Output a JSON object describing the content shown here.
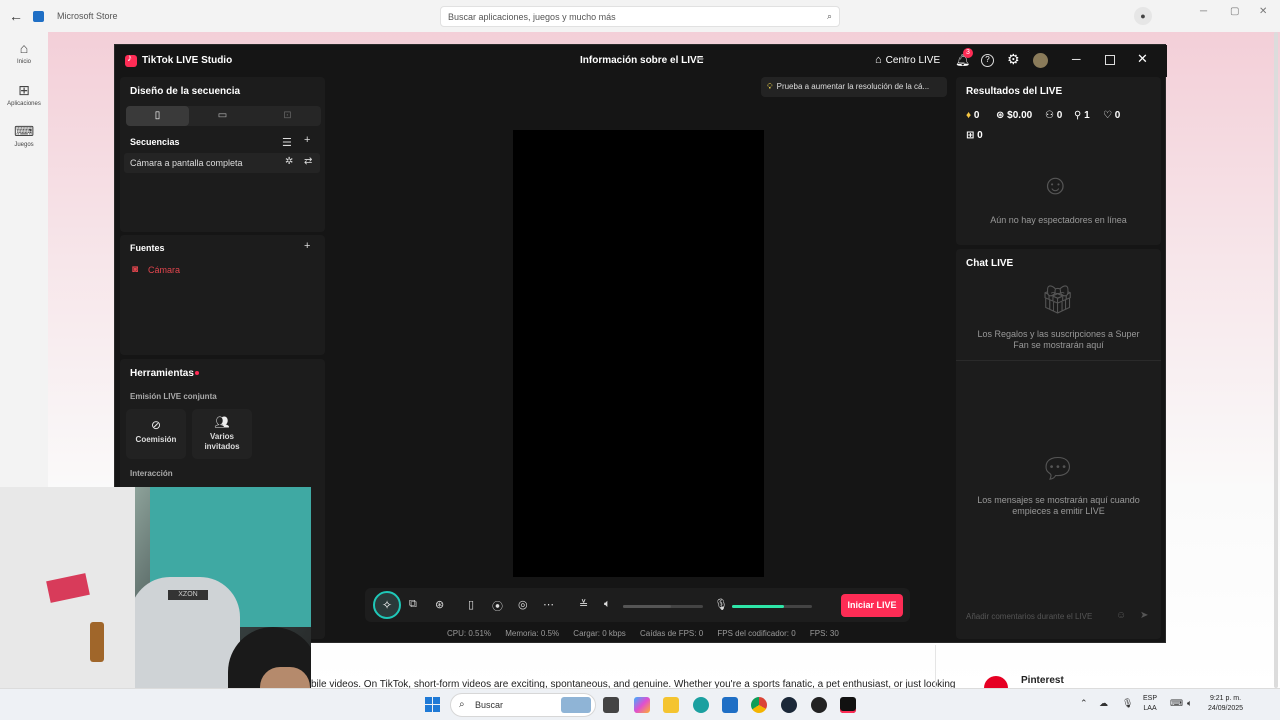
{
  "store": {
    "title": "Microsoft Store",
    "search_placeholder": "Buscar aplicaciones, juegos y mucho más",
    "nav": [
      {
        "label": "Inicio",
        "icon": "home-icon"
      },
      {
        "label": "Aplicaciones",
        "icon": "apps-icon"
      },
      {
        "label": "Juegos",
        "icon": "gamepad-icon"
      }
    ],
    "bottom_text": "bile videos. On TikTok, short-form videos are exciting, spontaneous, and genuine. Whether you're a sports fanatic, a pet enthusiast, or just looking",
    "pinterest_label": "Pinterest"
  },
  "tiktok": {
    "app_name": "TikTok LIVE Studio",
    "info_title": "Información sobre el LIVE",
    "centro_label": "Centro LIVE",
    "notification_count": "3",
    "design_panel": {
      "title": "Diseño de la secuencia",
      "sequences_title": "Secuencias",
      "sequence_item": "Cámara a pantalla completa"
    },
    "sources_panel": {
      "title": "Fuentes",
      "source_item": "Cámara"
    },
    "tools_panel": {
      "title": "Herramientas",
      "section_label": "Emisión LIVE conjunta",
      "coemision_label": "Coemisión",
      "varios_label_1": "Varios",
      "varios_label_2": "invitados",
      "interaction_label": "Interacción"
    },
    "hint": "Prueba a aumentar la resolución de la cá...",
    "start_button": "Iniciar LIVE",
    "volume_level": 0.6,
    "mic_level": 0.65,
    "status": {
      "cpu": "CPU:  0.51%",
      "memory": "Memoria:  0.5%",
      "load": "Cargar:  0 kbps",
      "fps_drops": "Caídas de FPS:  0",
      "encoder_fps": "FPS del codificador:  0",
      "fps": "FPS:  30"
    },
    "results": {
      "title": "Resultados del LIVE",
      "diamonds": "0",
      "money": "$0.00",
      "viewers": "0",
      "followers": "1",
      "likes": "0",
      "gifts": "0",
      "no_viewers": "Aún no hay espectadores en línea"
    },
    "chat": {
      "title": "Chat LIVE",
      "gifts_text_1": "Los Regalos y las suscripciones a Super",
      "gifts_text_2": "Fan se mostrarán aquí",
      "messages_text_1": "Los mensajes se mostrarán aquí cuando",
      "messages_text_2": "empieces a emitir LIVE",
      "input_placeholder": "Añadir comentarios durante el LIVE"
    }
  },
  "webcam": {
    "chair_brand": "XZON"
  },
  "taskbar": {
    "search_label": "Buscar",
    "lang_1": "ESP",
    "lang_2": "LAA",
    "time": "9:21 p. m.",
    "date": "24/09/2025"
  }
}
